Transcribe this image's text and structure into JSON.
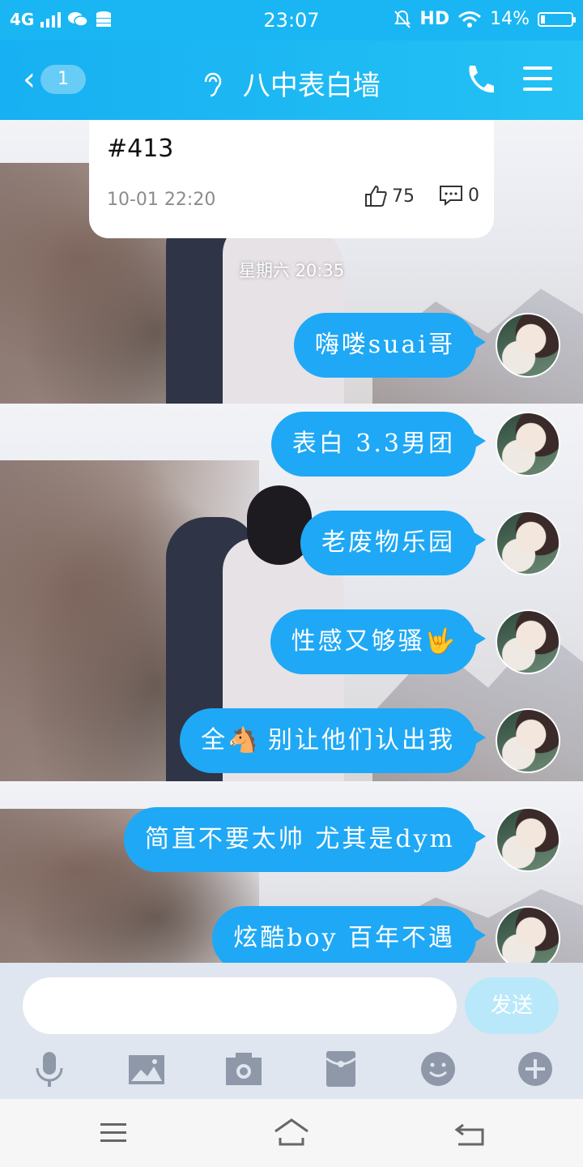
{
  "status_bar": {
    "network": "4G",
    "time": "23:07",
    "hd": "HD",
    "battery": "14%",
    "battery_level": 0.14
  },
  "header": {
    "back_count": "1",
    "title": "八中表白墙"
  },
  "post_card": {
    "number": "#413",
    "date": "10-01 22:20",
    "likes": "75",
    "comments": "0"
  },
  "chat": {
    "timestamp": "星期六 20:35",
    "messages": [
      {
        "text": "嗨喽suai哥"
      },
      {
        "text": "表白 3.3男团"
      },
      {
        "text": "老废物乐园"
      },
      {
        "text": "性感又够骚",
        "emoji": "🤟"
      },
      {
        "text_before": "全",
        "emoji": "🐴",
        "text": "别让他们认出我"
      },
      {
        "text": "简直不要太帅 尤其是dym"
      },
      {
        "text": "炫酷boy 百年不遇"
      }
    ]
  },
  "input": {
    "placeholder": "",
    "send_label": "发送"
  },
  "toolbar": [
    "mic-icon",
    "image-icon",
    "camera-icon",
    "red-packet-icon",
    "emoji-icon",
    "plus-icon"
  ],
  "colors": {
    "accent": "#19b6f3",
    "bubble": "#1fa8f5",
    "send_disabled": "#b9e8fa"
  }
}
